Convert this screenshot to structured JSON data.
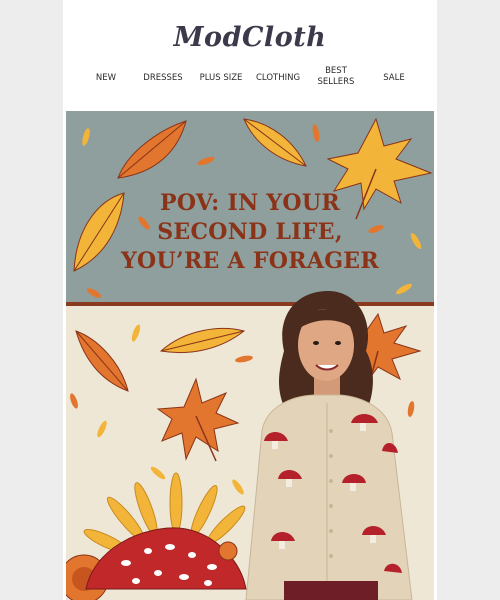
{
  "brand": {
    "logo_text": "ModCloth"
  },
  "nav": {
    "items": [
      {
        "label": "NEW"
      },
      {
        "label": "DRESSES"
      },
      {
        "label": "PLUS SIZE"
      },
      {
        "label": "CLOTHING"
      },
      {
        "label": "BEST SELLERS"
      },
      {
        "label": "SALE"
      }
    ]
  },
  "hero": {
    "headline_lines": [
      "POV: IN YOUR",
      "SECOND LIFE,",
      "YOU’RE A FORAGER"
    ]
  },
  "colors": {
    "sky": "#8e9f9d",
    "cream": "#efe7d6",
    "rust": "#8a3318",
    "leaf_orange": "#e2762f",
    "leaf_yellow": "#f2b53a",
    "mushroom_red": "#c0282a"
  }
}
